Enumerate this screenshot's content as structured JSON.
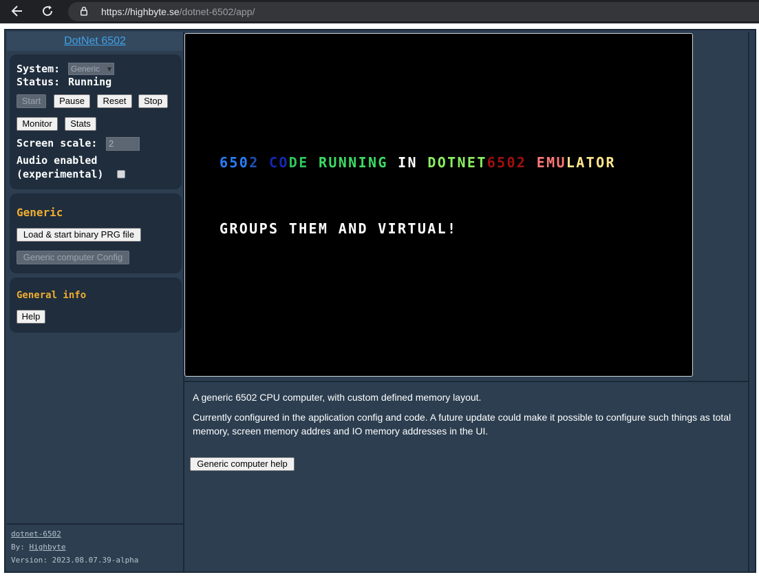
{
  "browser": {
    "url_domain": "https://highbyte.se",
    "url_path": "/dotnet-6502/app/"
  },
  "sidebar": {
    "app_link": "DotNet 6502",
    "system_label": "System:",
    "system_value": "Generic",
    "status_label": "Status:",
    "status_value": "Running",
    "buttons": {
      "start": "Start",
      "pause": "Pause",
      "reset": "Reset",
      "stop": "Stop",
      "monitor": "Monitor",
      "stats": "Stats"
    },
    "screen_scale_label": "Screen scale:",
    "screen_scale_value": "2",
    "audio_label_line1": "Audio enabled",
    "audio_label_line2": "(experimental)",
    "audio_checked": false,
    "generic": {
      "heading": "Generic",
      "load_button": "Load & start binary PRG file",
      "config_button": "Generic computer Config"
    },
    "general_info": {
      "heading": "General info",
      "help_button": "Help"
    },
    "footer": {
      "app_name": "dotnet-6502",
      "by_label": "By:",
      "author": "Highbyte",
      "version": "Version: 2023.08.07.39-alpha"
    }
  },
  "screen": {
    "line1_segments": [
      {
        "text": "650",
        "color": "#2a7fff"
      },
      {
        "text": "2",
        "color": "#1e50b4"
      },
      {
        "text": " ",
        "color": "#ffffff"
      },
      {
        "text": "CO",
        "color": "#1428b4"
      },
      {
        "text": "DE",
        "color": "#2ec85a"
      },
      {
        "text": " ",
        "color": "#ffffff"
      },
      {
        "text": "RUNNING",
        "color": "#3cdc64"
      },
      {
        "text": " ",
        "color": "#ffffff"
      },
      {
        "text": "IN",
        "color": "#ffffff"
      },
      {
        "text": " ",
        "color": "#ffffff"
      },
      {
        "text": "DOTNET",
        "color": "#8cf060"
      },
      {
        "text": "6502",
        "color": "#a01010"
      },
      {
        "text": " ",
        "color": "#ffffff"
      },
      {
        "text": "EMU",
        "color": "#ff7878"
      },
      {
        "text": "LATOR",
        "color": "#ffe68c"
      }
    ],
    "line2": "GROUPS THEM AND VIRTUAL!"
  },
  "description": {
    "line1": "A generic 6502 CPU computer, with custom defined memory layout.",
    "line2": "Currently configured in the application config and code. A future update could make it possible to configure such things as total memory, screen memory addres and IO memory addresses in the UI.",
    "help_button": "Generic computer help"
  },
  "colors": {
    "panel_bg": "#1f2d3d",
    "app_bg": "#2c3e50",
    "heading_orange": "#f0ad30",
    "link_blue": "#41a0e6"
  }
}
